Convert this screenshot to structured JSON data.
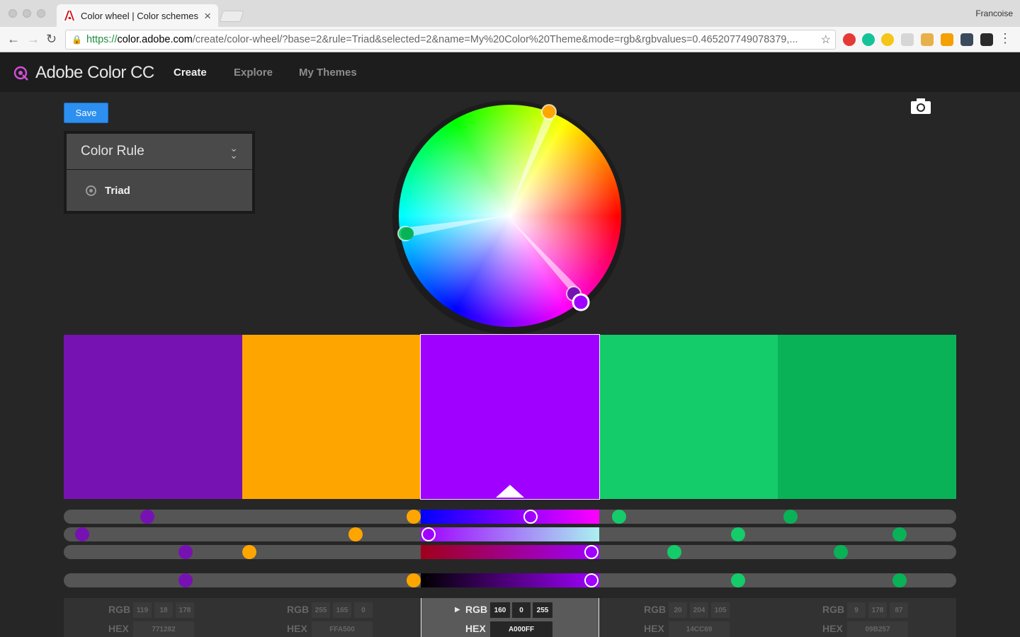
{
  "browser": {
    "tab_title": "Color wheel | Color schemes - ",
    "tab_close": "×",
    "profile_name": "Francoise",
    "url_scheme": "https://",
    "url_host": "color.adobe.com",
    "url_rest": "/create/color-wheel/?base=2&rule=Triad&selected=2&name=My%20Color%20Theme&mode=rgb&rgbvalues=0.465207749078379,...",
    "back_icon": "arrow-left-icon",
    "forward_icon": "arrow-right-icon",
    "reload_icon": "reload-icon",
    "lock_icon": "lock-icon",
    "star_icon": "star-icon",
    "menu_icon": "more-vert-icon"
  },
  "app": {
    "logo_text": "Adobe Color CC",
    "nav": [
      {
        "label": "Create",
        "active": true
      },
      {
        "label": "Explore",
        "active": false
      },
      {
        "label": "My Themes",
        "active": false
      }
    ],
    "save_label": "Save",
    "camera_icon": "camera-icon"
  },
  "color_rule": {
    "title": "Color Rule",
    "selected": "Triad",
    "chevron_icon": "double-chevron-down-icon",
    "radio_icon": "radio-selected-icon"
  },
  "mode": "RGB",
  "selected_index": 2,
  "swatches": [
    {
      "hex": "771282",
      "rgb": [
        "119",
        "18",
        "178"
      ],
      "color": "#7712B2"
    },
    {
      "hex": "FFA500",
      "rgb": [
        "255",
        "165",
        "0"
      ],
      "color": "#FFA500"
    },
    {
      "hex": "A000FF",
      "rgb": [
        "160",
        "0",
        "255"
      ],
      "color": "#A000FF"
    },
    {
      "hex": "14CC69",
      "rgb": [
        "20",
        "204",
        "105"
      ],
      "color": "#14CC69"
    },
    {
      "hex": "09B257",
      "rgb": [
        "9",
        "178",
        "87"
      ],
      "color": "#09B257"
    }
  ],
  "labels": {
    "rgb": "RGB",
    "hex": "HEX"
  }
}
